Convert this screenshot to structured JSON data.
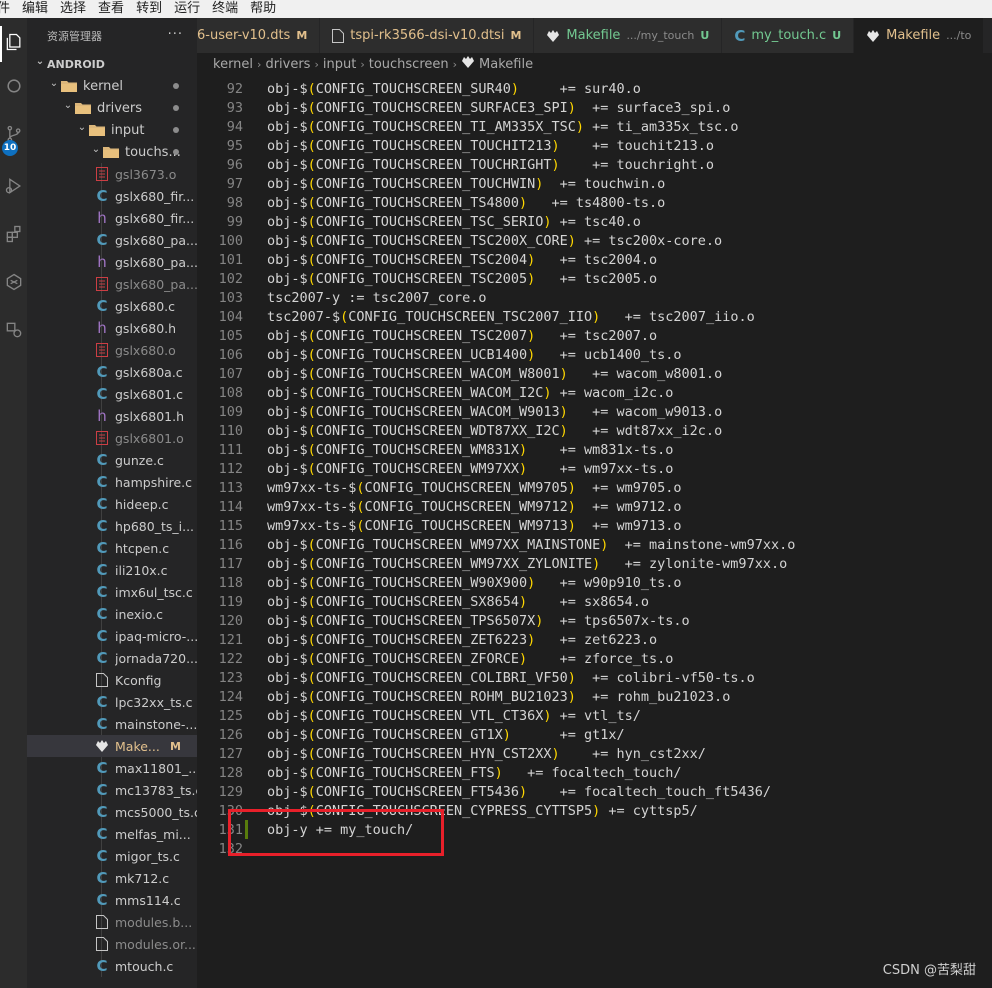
{
  "menubar": {
    "items": [
      "件",
      "编辑",
      "选择",
      "查看",
      "转到",
      "运行",
      "终端",
      "帮助"
    ]
  },
  "activitybar": {
    "icons": [
      "explorer-icon",
      "search-icon",
      "source-control-icon",
      "run-debug-icon",
      "extensions-icon",
      "remote-icon",
      "settings-sync-icon"
    ],
    "badge": "10",
    "accent": "#0e70c0"
  },
  "sidebar": {
    "title": "资源管理器",
    "more": "···",
    "tree": [
      {
        "label": "ANDROID",
        "kind": "root"
      },
      {
        "label": "kernel",
        "kind": "folder"
      },
      {
        "label": "drivers",
        "kind": "folder"
      },
      {
        "label": "input",
        "kind": "folder"
      },
      {
        "label": "touchs...",
        "kind": "folder"
      }
    ],
    "files": [
      {
        "name": "gsl3673.o",
        "type": "o"
      },
      {
        "name": "gslx680_fir...",
        "type": "c"
      },
      {
        "name": "gslx680_fir...",
        "type": "h"
      },
      {
        "name": "gslx680_pa...",
        "type": "c"
      },
      {
        "name": "gslx680_pa...",
        "type": "h"
      },
      {
        "name": "gslx680_pa...",
        "type": "o"
      },
      {
        "name": "gslx680.c",
        "type": "c"
      },
      {
        "name": "gslx680.h",
        "type": "h"
      },
      {
        "name": "gslx680.o",
        "type": "o"
      },
      {
        "name": "gslx680a.c",
        "type": "c"
      },
      {
        "name": "gslx6801.c",
        "type": "c"
      },
      {
        "name": "gslx6801.h",
        "type": "h"
      },
      {
        "name": "gslx6801.o",
        "type": "o"
      },
      {
        "name": "gunze.c",
        "type": "c"
      },
      {
        "name": "hampshire.c",
        "type": "c"
      },
      {
        "name": "hideep.c",
        "type": "c"
      },
      {
        "name": "hp680_ts_i...",
        "type": "c"
      },
      {
        "name": "htcpen.c",
        "type": "c"
      },
      {
        "name": "ili210x.c",
        "type": "c"
      },
      {
        "name": "imx6ul_tsc.c",
        "type": "c"
      },
      {
        "name": "inexio.c",
        "type": "c"
      },
      {
        "name": "ipaq-micro-...",
        "type": "c"
      },
      {
        "name": "jornada720...",
        "type": "c"
      },
      {
        "name": "Kconfig",
        "type": "file"
      },
      {
        "name": "lpc32xx_ts.c",
        "type": "c"
      },
      {
        "name": "mainstone-...",
        "type": "c"
      },
      {
        "name": "Make...",
        "type": "make",
        "badge": "M",
        "selected": true
      },
      {
        "name": "max11801_...",
        "type": "c"
      },
      {
        "name": "mc13783_ts.c",
        "type": "c"
      },
      {
        "name": "mcs5000_ts.c",
        "type": "c"
      },
      {
        "name": "melfas_mi...",
        "type": "c"
      },
      {
        "name": "migor_ts.c",
        "type": "c"
      },
      {
        "name": "mk712.c",
        "type": "c"
      },
      {
        "name": "mms114.c",
        "type": "c"
      },
      {
        "name": "modules.b...",
        "type": "file",
        "dim": true
      },
      {
        "name": "modules.or...",
        "type": "file",
        "dim": true
      },
      {
        "name": "mtouch.c",
        "type": "c"
      }
    ]
  },
  "tabs": [
    {
      "label": "6-user-v10.dts",
      "badge": "M",
      "status": "m",
      "icon": "none"
    },
    {
      "label": "tspi-rk3566-dsi-v10.dtsi",
      "badge": "M",
      "status": "m",
      "icon": "file"
    },
    {
      "label": "Makefile",
      "desc": ".../my_touch",
      "badge": "U",
      "status": "u",
      "icon": "make"
    },
    {
      "label": "my_touch.c",
      "badge": "U",
      "status": "u",
      "icon": "c"
    },
    {
      "label": "Makefile",
      "desc": ".../to",
      "badge": "",
      "status": "m",
      "icon": "make",
      "active": true
    }
  ],
  "breadcrumb": [
    "kernel",
    "drivers",
    "input",
    "touchscreen",
    "Makefile"
  ],
  "editor": {
    "lines": [
      {
        "n": "92",
        "pre": "obj-$",
        "cfg": "CONFIG_TOUCHSCREEN_SUR40",
        "post": "     += sur40.o"
      },
      {
        "n": "93",
        "pre": "obj-$",
        "cfg": "CONFIG_TOUCHSCREEN_SURFACE3_SPI",
        "post": "  += surface3_spi.o"
      },
      {
        "n": "94",
        "pre": "obj-$",
        "cfg": "CONFIG_TOUCHSCREEN_TI_AM335X_TSC",
        "post": " += ti_am335x_tsc.o"
      },
      {
        "n": "95",
        "pre": "obj-$",
        "cfg": "CONFIG_TOUCHSCREEN_TOUCHIT213",
        "post": "    += touchit213.o"
      },
      {
        "n": "96",
        "pre": "obj-$",
        "cfg": "CONFIG_TOUCHSCREEN_TOUCHRIGHT",
        "post": "    += touchright.o"
      },
      {
        "n": "97",
        "pre": "obj-$",
        "cfg": "CONFIG_TOUCHSCREEN_TOUCHWIN",
        "post": "  += touchwin.o"
      },
      {
        "n": "98",
        "pre": "obj-$",
        "cfg": "CONFIG_TOUCHSCREEN_TS4800",
        "post": "   += ts4800-ts.o"
      },
      {
        "n": "99",
        "pre": "obj-$",
        "cfg": "CONFIG_TOUCHSCREEN_TSC_SERIO",
        "post": " += tsc40.o"
      },
      {
        "n": "100",
        "pre": "obj-$",
        "cfg": "CONFIG_TOUCHSCREEN_TSC200X_CORE",
        "post": " += tsc200x-core.o"
      },
      {
        "n": "101",
        "pre": "obj-$",
        "cfg": "CONFIG_TOUCHSCREEN_TSC2004",
        "post": "   += tsc2004.o"
      },
      {
        "n": "102",
        "pre": "obj-$",
        "cfg": "CONFIG_TOUCHSCREEN_TSC2005",
        "post": "   += tsc2005.o"
      },
      {
        "n": "103",
        "pre": "tsc2007-y := tsc2007_core.o",
        "cfg": "",
        "post": ""
      },
      {
        "n": "104",
        "pre": "tsc2007-$",
        "cfg": "CONFIG_TOUCHSCREEN_TSC2007_IIO",
        "post": "   += tsc2007_iio.o"
      },
      {
        "n": "105",
        "pre": "obj-$",
        "cfg": "CONFIG_TOUCHSCREEN_TSC2007",
        "post": "   += tsc2007.o"
      },
      {
        "n": "106",
        "pre": "obj-$",
        "cfg": "CONFIG_TOUCHSCREEN_UCB1400",
        "post": "   += ucb1400_ts.o"
      },
      {
        "n": "107",
        "pre": "obj-$",
        "cfg": "CONFIG_TOUCHSCREEN_WACOM_W8001",
        "post": "   += wacom_w8001.o"
      },
      {
        "n": "108",
        "pre": "obj-$",
        "cfg": "CONFIG_TOUCHSCREEN_WACOM_I2C",
        "post": " += wacom_i2c.o"
      },
      {
        "n": "109",
        "pre": "obj-$",
        "cfg": "CONFIG_TOUCHSCREEN_WACOM_W9013",
        "post": "   += wacom_w9013.o"
      },
      {
        "n": "110",
        "pre": "obj-$",
        "cfg": "CONFIG_TOUCHSCREEN_WDT87XX_I2C",
        "post": "   += wdt87xx_i2c.o"
      },
      {
        "n": "111",
        "pre": "obj-$",
        "cfg": "CONFIG_TOUCHSCREEN_WM831X",
        "post": "    += wm831x-ts.o"
      },
      {
        "n": "112",
        "pre": "obj-$",
        "cfg": "CONFIG_TOUCHSCREEN_WM97XX",
        "post": "    += wm97xx-ts.o"
      },
      {
        "n": "113",
        "pre": "wm97xx-ts-$",
        "cfg": "CONFIG_TOUCHSCREEN_WM9705",
        "post": "  += wm9705.o"
      },
      {
        "n": "114",
        "pre": "wm97xx-ts-$",
        "cfg": "CONFIG_TOUCHSCREEN_WM9712",
        "post": "  += wm9712.o"
      },
      {
        "n": "115",
        "pre": "wm97xx-ts-$",
        "cfg": "CONFIG_TOUCHSCREEN_WM9713",
        "post": "  += wm9713.o"
      },
      {
        "n": "116",
        "pre": "obj-$",
        "cfg": "CONFIG_TOUCHSCREEN_WM97XX_MAINSTONE",
        "post": "  += mainstone-wm97xx.o"
      },
      {
        "n": "117",
        "pre": "obj-$",
        "cfg": "CONFIG_TOUCHSCREEN_WM97XX_ZYLONITE",
        "post": "   += zylonite-wm97xx.o"
      },
      {
        "n": "118",
        "pre": "obj-$",
        "cfg": "CONFIG_TOUCHSCREEN_W90X900",
        "post": "   += w90p910_ts.o"
      },
      {
        "n": "119",
        "pre": "obj-$",
        "cfg": "CONFIG_TOUCHSCREEN_SX8654",
        "post": "    += sx8654.o"
      },
      {
        "n": "120",
        "pre": "obj-$",
        "cfg": "CONFIG_TOUCHSCREEN_TPS6507X",
        "post": "  += tps6507x-ts.o"
      },
      {
        "n": "121",
        "pre": "obj-$",
        "cfg": "CONFIG_TOUCHSCREEN_ZET6223",
        "post": "   += zet6223.o"
      },
      {
        "n": "122",
        "pre": "obj-$",
        "cfg": "CONFIG_TOUCHSCREEN_ZFORCE",
        "post": "    += zforce_ts.o"
      },
      {
        "n": "123",
        "pre": "obj-$",
        "cfg": "CONFIG_TOUCHSCREEN_COLIBRI_VF50",
        "post": "  += colibri-vf50-ts.o"
      },
      {
        "n": "124",
        "pre": "obj-$",
        "cfg": "CONFIG_TOUCHSCREEN_ROHM_BU21023",
        "post": "  += rohm_bu21023.o"
      },
      {
        "n": "125",
        "pre": "obj-$",
        "cfg": "CONFIG_TOUCHSCREEN_VTL_CT36X",
        "post": " += vtl_ts/"
      },
      {
        "n": "126",
        "pre": "obj-$",
        "cfg": "CONFIG_TOUCHSCREEN_GT1X",
        "post": "      += gt1x/"
      },
      {
        "n": "127",
        "pre": "obj-$",
        "cfg": "CONFIG_TOUCHSCREEN_HYN_CST2XX",
        "post": "    += hyn_cst2xx/"
      },
      {
        "n": "128",
        "pre": "obj-$",
        "cfg": "CONFIG_TOUCHSCREEN_FTS",
        "post": "   += focaltech_touch/"
      },
      {
        "n": "129",
        "pre": "obj-$",
        "cfg": "CONFIG_TOUCHSCREEN_FT5436",
        "post": "    += focaltech_touch_ft5436/"
      },
      {
        "n": "130",
        "pre": "obj-$",
        "cfg": "CONFIG_TOUCHSCREEN_CYPRESS_CYTTSP5",
        "post": " += cyttsp5/"
      },
      {
        "n": "131",
        "pre": "obj-y += my_touch/",
        "cfg": "",
        "post": ""
      },
      {
        "n": "132",
        "pre": "",
        "cfg": "",
        "post": ""
      }
    ]
  },
  "colors": {
    "highlight_box": "#e8202a",
    "git_added": "#587c0c",
    "bracket": "#ffd700",
    "modified": "#e2c08d",
    "untracked": "#73c991"
  },
  "watermark": "CSDN @苦梨甜"
}
